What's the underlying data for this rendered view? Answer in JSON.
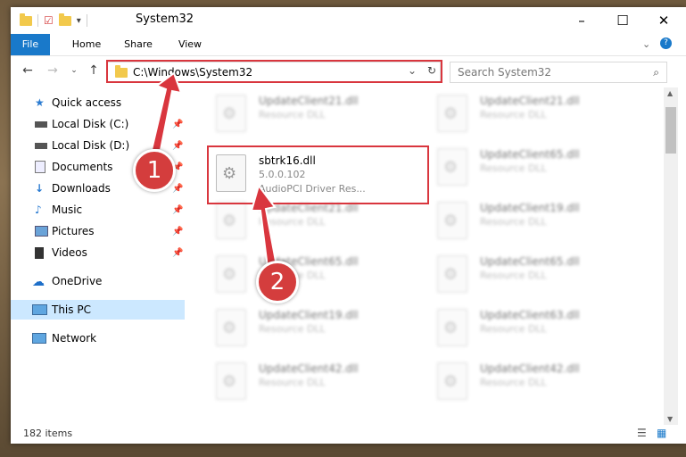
{
  "window": {
    "title": "System32",
    "controls": {
      "minimize": "–",
      "maximize": "☐",
      "close": "✕"
    }
  },
  "ribbon": {
    "tabs": [
      "File",
      "Home",
      "Share",
      "View"
    ],
    "expand_icon": "chevron-down-icon",
    "help_icon": "help-icon"
  },
  "nav": {
    "address": "C:\\Windows\\System32",
    "search_placeholder": "Search System32"
  },
  "sidebar": {
    "items": [
      {
        "label": "Quick access",
        "icon": "star-icon",
        "pinned": false
      },
      {
        "label": "Local Disk (C:)",
        "icon": "drive-icon",
        "pinned": true
      },
      {
        "label": "Local Disk (D:)",
        "icon": "drive-icon",
        "pinned": true
      },
      {
        "label": "Documents",
        "icon": "documents-icon",
        "pinned": true
      },
      {
        "label": "Downloads",
        "icon": "download-icon",
        "pinned": true
      },
      {
        "label": "Music",
        "icon": "music-icon",
        "pinned": true
      },
      {
        "label": "Pictures",
        "icon": "pictures-icon",
        "pinned": true
      },
      {
        "label": "Videos",
        "icon": "videos-icon",
        "pinned": true
      },
      {
        "label": "OneDrive",
        "icon": "cloud-icon",
        "pinned": false
      },
      {
        "label": "This PC",
        "icon": "pc-icon",
        "pinned": false
      },
      {
        "label": "Network",
        "icon": "network-icon",
        "pinned": false
      }
    ]
  },
  "files": {
    "left": [
      {
        "name": "UpdateClient21.dll",
        "type": "Resource DLL"
      },
      {
        "name": "sbtrk16.dll",
        "version": "5.0.0.102",
        "desc": "AudioPCI Driver Res..."
      },
      {
        "name": "UpdateClient21.dll",
        "type": "Resource DLL"
      },
      {
        "name": "UpdateClient65.dll",
        "type": "Resource DLL"
      },
      {
        "name": "UpdateClient19.dll",
        "type": "Resource DLL"
      },
      {
        "name": "UpdateClient42.dll",
        "type": "Resource DLL"
      }
    ],
    "right": [
      {
        "name": "UpdateClient21.dll",
        "type": "Resource DLL"
      },
      {
        "name": "UpdateClient65.dll",
        "type": "Resource DLL"
      },
      {
        "name": "UpdateClient19.dll",
        "type": "Resource DLL"
      },
      {
        "name": "UpdateClient65.dll",
        "type": "Resource DLL"
      },
      {
        "name": "UpdateClient63.dll",
        "type": "Resource DLL"
      },
      {
        "name": "UpdateClient42.dll",
        "type": "Resource DLL"
      }
    ]
  },
  "status": {
    "count": "182 items"
  },
  "annotations": {
    "step1": "1",
    "step2": "2",
    "color": "#d9363e"
  }
}
